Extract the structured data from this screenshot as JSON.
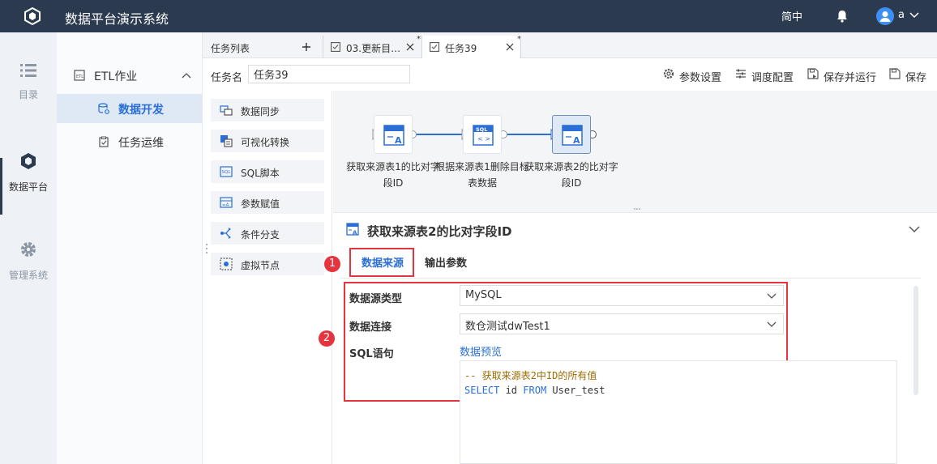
{
  "app": {
    "title": "数据平台演示系统",
    "lang": "简中",
    "user": "a"
  },
  "leftnav": [
    {
      "label": "目录",
      "icon": "list-icon"
    },
    {
      "label": "数据平台",
      "icon": "cube-icon"
    },
    {
      "label": "管理系统",
      "icon": "gear-icon"
    }
  ],
  "sidebar": {
    "group": "ETL作业",
    "items": [
      {
        "label": "数据开发",
        "selected": true
      },
      {
        "label": "任务运维",
        "selected": false
      }
    ]
  },
  "tabs": {
    "list_label": "任务列表",
    "items": [
      {
        "label": "03.更新目…",
        "modified": "*"
      },
      {
        "label": "任务39",
        "modified": "*"
      }
    ]
  },
  "task": {
    "name_label": "任务名",
    "name_value": "任务39"
  },
  "toolbar": {
    "params": "参数设置",
    "schedule": "调度配置",
    "save_run": "保存并运行",
    "save": "保存"
  },
  "palette": [
    "数据同步",
    "可视化转换",
    "SQL脚本",
    "参数赋值",
    "条件分支",
    "虚拟节点"
  ],
  "flow": {
    "nodes": [
      "获取来源表1的比对字段ID",
      "根据来源表1删除目标表数据",
      "获取来源表2的比对字段ID"
    ]
  },
  "detail": {
    "title": "获取来源表2的比对字段ID",
    "tabs": [
      "数据来源",
      "输出参数"
    ],
    "badges": [
      "1",
      "2"
    ],
    "fields": {
      "type_label": "数据源类型",
      "type_value": "MySQL",
      "conn_label": "数据连接",
      "conn_value": "数仓测试dwTest1",
      "sql_label": "SQL语句",
      "preview": "数据预览"
    },
    "sql": {
      "comment": "-- 获取来源表2中ID的所有值",
      "kw1": "SELECT",
      "mid": " id ",
      "kw2": "FROM",
      "rest": " User_test"
    }
  },
  "colors": {
    "topbar": "#2b3a4f",
    "accent": "#2b6fd6",
    "highlight": "#e5343e"
  }
}
